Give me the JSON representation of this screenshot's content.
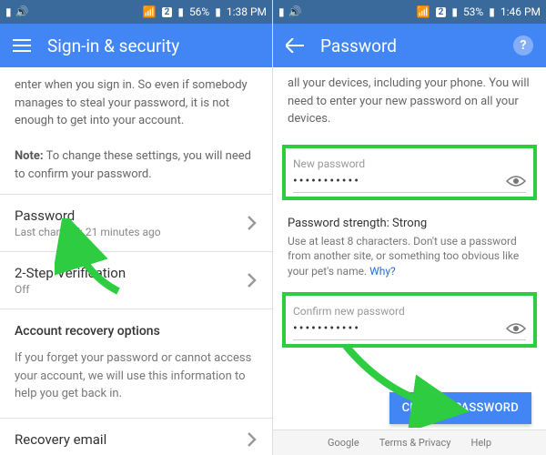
{
  "left": {
    "status": {
      "battery": "56%",
      "time": "1:38 PM"
    },
    "title": "Sign-in & security",
    "intro_top": "enter when you sign in. So even if somebody manages to steal your password, it is not enough to get into your account.",
    "note_label": "Note:",
    "note_text": " To change these settings, you will need to confirm your password.",
    "password": {
      "title": "Password",
      "sub": "Last changed: 21 minutes ago"
    },
    "twostep": {
      "title": "2-Step Verification",
      "sub": "Off"
    },
    "recovery": {
      "head": "Account recovery options",
      "text": "If you forget your password or cannot access your account, we will use this information to help you get back in."
    },
    "cutoff": "Recovery email"
  },
  "right": {
    "status": {
      "battery": "53%",
      "time": "1:46 PM"
    },
    "title": "Password",
    "intro": "all your devices, including your phone. You will need to enter your new password on all your devices.",
    "new_pw": {
      "label": "New password",
      "value": "•••••••••••"
    },
    "strength_label": "Password strength:",
    "strength_value": " Strong",
    "strength_desc": "Use at least 8 characters. Don't use a password from another site, or something too obvious like your pet's name. ",
    "why": "Why?",
    "confirm_pw": {
      "label": "Confirm new password",
      "value": "•••••••••••"
    },
    "change_btn": "CHANGE PASSWORD",
    "footer": {
      "google": "Google",
      "terms": "Terms & Privacy",
      "help": "Help"
    }
  }
}
